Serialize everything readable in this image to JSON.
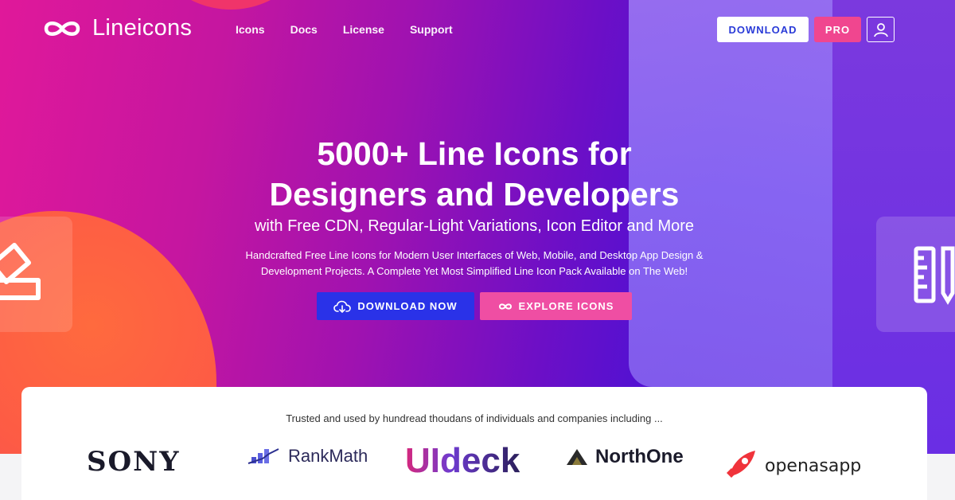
{
  "brand": {
    "name": "Lineicons"
  },
  "nav": {
    "items": [
      "Icons",
      "Docs",
      "License",
      "Support"
    ]
  },
  "header": {
    "download_label": "DOWNLOAD",
    "pro_label": "PRO"
  },
  "hero": {
    "headline_line1": "5000+ Line Icons for",
    "headline_line2": "Designers and Developers",
    "subheadline": "with Free CDN, Regular-Light Variations, Icon Editor and More",
    "description_line1": "Handcrafted Free Line Icons for Modern User Interfaces of Web, Mobile, and Desktop App Design &",
    "description_line2": "Development Projects. A Complete Yet Most Simplified Line Icon Pack Available on The Web!",
    "cta_download": "DOWNLOAD NOW",
    "cta_explore": "EXPLORE ICONS"
  },
  "trusted": {
    "text": "Trusted and used by hundread thoudans of individuals and companies including ...",
    "brands": [
      "SONY",
      "RankMath",
      "UIdeck",
      "NorthOne",
      "openasapp"
    ]
  },
  "colors": {
    "accent_blue": "#2a32e8",
    "accent_pink": "#ef4ea3",
    "download_text": "#2a3bd8",
    "pro_bg": "#f0468f"
  },
  "icons": {
    "logo": "infinity-icon",
    "user": "user-icon",
    "cloud": "cloud-download-icon",
    "infinity": "infinity-icon",
    "tile_left": "edit-icon",
    "tile_right": "ruler-pencil-icon"
  }
}
